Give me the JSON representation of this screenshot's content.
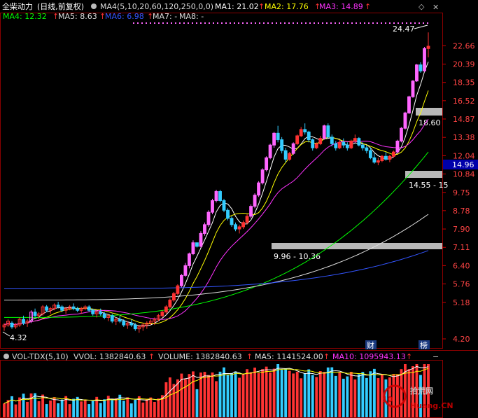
{
  "title": "全柴动力",
  "mode": "(日线,前复权)",
  "indicator_header": {
    "ma_def": "MA4(5,10,20,60,120,250,0,0)",
    "items": [
      {
        "label": "MA1: 21.02",
        "color": "#ffffff"
      },
      {
        "label": "MA2: 17.76",
        "color": "#ffff00"
      },
      {
        "label": "MA3: 14.89",
        "color": "#ff33ff"
      },
      {
        "label": "MA4: 12.32",
        "color": "#00ff00"
      },
      {
        "label": "MA5: 8.63",
        "color": "#dddddd"
      },
      {
        "label": "MA6: 6.98",
        "color": "#3355ff"
      },
      {
        "label": "MA7: -",
        "color": "#dddddd"
      },
      {
        "label": "MA8: -",
        "color": "#dddddd"
      }
    ]
  },
  "price_axis_labels": [
    "22.66",
    "20.39",
    "18.35",
    "16.52",
    "14.87",
    "13.38",
    "12.04",
    "10.84",
    "9.75",
    "8.78",
    "7.90",
    "7.11",
    "6.40",
    "5.76",
    "5.18",
    "4.20"
  ],
  "current_price": "14.96",
  "annotations": {
    "high": "24.47",
    "low": "4.32",
    "level1": "18.60",
    "level2": "14.55 - 15",
    "level3": "9.96 - 10.36"
  },
  "markers": {
    "cai": "财",
    "bang": "榜"
  },
  "volume_header": {
    "name": "VOL-TDX(5,10)",
    "vvol": "VVOL: 1382840.63",
    "volume": "VOLUME: 1382840.63",
    "ma5": "MA5: 1141524.00",
    "ma10": "MA10: 1095943.13"
  },
  "watermark": {
    "number": "10",
    "site": "拾荒网",
    "url": "Huang.CN"
  },
  "colors": {
    "up": "#ff3333",
    "down": "#33ccff",
    "bg": "#000000",
    "grid": "#8b0000",
    "accent": "#ff33ff"
  },
  "chart_data": {
    "type": "candlestick",
    "y_scale": "log",
    "ylim": [
      4.2,
      25.5
    ],
    "candles": [
      [
        4.5,
        4.6,
        4.4,
        4.55
      ],
      [
        4.55,
        4.7,
        4.5,
        4.65
      ],
      [
        4.6,
        4.65,
        4.45,
        4.5
      ],
      [
        4.5,
        4.6,
        4.45,
        4.55
      ],
      [
        4.55,
        4.75,
        4.5,
        4.7
      ],
      [
        4.7,
        4.8,
        4.55,
        4.6
      ],
      [
        4.6,
        4.7,
        4.5,
        4.65
      ],
      [
        4.65,
        4.95,
        4.6,
        4.9
      ],
      [
        4.9,
        5.0,
        4.75,
        4.8
      ],
      [
        4.8,
        4.9,
        4.7,
        4.85
      ],
      [
        4.85,
        5.1,
        4.8,
        5.05
      ],
      [
        5.05,
        5.1,
        4.9,
        4.95
      ],
      [
        4.95,
        5.05,
        4.85,
        5.0
      ],
      [
        5.0,
        5.15,
        4.95,
        5.1
      ],
      [
        5.1,
        5.2,
        5.0,
        5.05
      ],
      [
        5.05,
        5.1,
        4.9,
        4.95
      ],
      [
        4.95,
        5.05,
        4.85,
        5.0
      ],
      [
        5.0,
        5.1,
        4.95,
        5.05
      ],
      [
        5.05,
        5.15,
        4.95,
        5.0
      ],
      [
        5.0,
        5.05,
        4.9,
        4.95
      ],
      [
        4.95,
        5.05,
        4.85,
        5.0
      ],
      [
        5.0,
        5.1,
        4.95,
        5.05
      ],
      [
        5.05,
        5.1,
        4.9,
        4.95
      ],
      [
        4.95,
        5.0,
        4.8,
        4.85
      ],
      [
        4.85,
        4.95,
        4.75,
        4.9
      ],
      [
        4.9,
        5.0,
        4.8,
        4.85
      ],
      [
        4.85,
        4.9,
        4.7,
        4.75
      ],
      [
        4.75,
        4.85,
        4.65,
        4.8
      ],
      [
        4.8,
        4.85,
        4.6,
        4.65
      ],
      [
        4.65,
        4.75,
        4.55,
        4.7
      ],
      [
        4.7,
        4.8,
        4.6,
        4.65
      ],
      [
        4.65,
        4.7,
        4.5,
        4.55
      ],
      [
        4.55,
        4.65,
        4.45,
        4.6
      ],
      [
        4.6,
        4.7,
        4.5,
        4.55
      ],
      [
        4.55,
        4.6,
        4.4,
        4.45
      ],
      [
        4.45,
        4.55,
        4.35,
        4.5
      ],
      [
        4.5,
        4.6,
        4.4,
        4.55
      ],
      [
        4.55,
        4.65,
        4.45,
        4.6
      ],
      [
        4.6,
        4.7,
        4.55,
        4.65
      ],
      [
        4.65,
        4.75,
        4.55,
        4.7
      ],
      [
        4.7,
        4.85,
        4.65,
        4.8
      ],
      [
        4.8,
        4.95,
        4.75,
        4.9
      ],
      [
        4.9,
        5.1,
        4.85,
        5.05
      ],
      [
        5.05,
        5.3,
        5.0,
        5.25
      ],
      [
        5.25,
        5.5,
        5.2,
        5.45
      ],
      [
        5.45,
        5.75,
        5.4,
        5.7
      ],
      [
        5.7,
        6.1,
        5.65,
        6.05
      ],
      [
        6.05,
        6.5,
        6.0,
        6.4
      ],
      [
        6.4,
        6.9,
        6.3,
        6.85
      ],
      [
        6.85,
        7.4,
        6.8,
        7.3
      ],
      [
        7.3,
        7.2,
        7.1,
        7.15
      ],
      [
        7.15,
        7.8,
        7.1,
        7.7
      ],
      [
        7.7,
        8.2,
        7.6,
        8.1
      ],
      [
        8.1,
        8.8,
        8.0,
        8.7
      ],
      [
        8.7,
        9.4,
        8.6,
        9.3
      ],
      [
        9.3,
        9.9,
        9.2,
        9.8
      ],
      [
        9.8,
        9.9,
        9.2,
        9.3
      ],
      [
        9.3,
        9.4,
        8.7,
        8.8
      ],
      [
        8.8,
        8.9,
        8.3,
        8.4
      ],
      [
        8.4,
        8.5,
        8.0,
        8.1
      ],
      [
        8.1,
        8.2,
        7.8,
        7.9
      ],
      [
        7.9,
        8.1,
        7.7,
        8.0
      ],
      [
        8.0,
        8.3,
        7.9,
        8.2
      ],
      [
        8.2,
        8.6,
        8.1,
        8.5
      ],
      [
        8.5,
        9.1,
        8.4,
        9.0
      ],
      [
        9.0,
        9.7,
        8.9,
        9.6
      ],
      [
        9.6,
        10.4,
        9.5,
        10.3
      ],
      [
        10.3,
        11.2,
        10.2,
        11.1
      ],
      [
        11.1,
        12.0,
        11.0,
        11.9
      ],
      [
        11.9,
        12.9,
        11.8,
        12.8
      ],
      [
        12.8,
        13.8,
        12.6,
        13.7
      ],
      [
        13.7,
        14.3,
        13.0,
        13.2
      ],
      [
        13.2,
        13.4,
        12.2,
        12.4
      ],
      [
        12.4,
        12.6,
        11.6,
        11.8
      ],
      [
        11.8,
        12.3,
        11.7,
        12.2
      ],
      [
        12.2,
        13.0,
        12.1,
        12.9
      ],
      [
        12.9,
        13.6,
        12.8,
        13.5
      ],
      [
        13.5,
        14.2,
        13.4,
        14.0
      ],
      [
        14.0,
        14.5,
        13.6,
        13.8
      ],
      [
        13.8,
        13.9,
        13.0,
        13.2
      ],
      [
        13.2,
        13.3,
        12.4,
        12.6
      ],
      [
        12.6,
        13.0,
        12.5,
        12.9
      ],
      [
        12.9,
        13.5,
        12.8,
        13.3
      ],
      [
        13.3,
        14.4,
        13.2,
        14.3
      ],
      [
        14.3,
        14.5,
        13.3,
        13.4
      ],
      [
        13.4,
        13.6,
        12.7,
        12.9
      ],
      [
        12.9,
        13.1,
        12.4,
        12.6
      ],
      [
        12.6,
        13.2,
        12.5,
        13.0
      ],
      [
        13.0,
        13.3,
        12.6,
        12.8
      ],
      [
        12.8,
        13.0,
        12.4,
        12.6
      ],
      [
        12.6,
        13.2,
        12.5,
        13.1
      ],
      [
        13.1,
        13.6,
        13.0,
        13.3
      ],
      [
        13.3,
        13.4,
        12.7,
        12.8
      ],
      [
        12.8,
        13.0,
        12.4,
        12.6
      ],
      [
        12.6,
        12.8,
        12.2,
        12.4
      ],
      [
        12.4,
        12.6,
        11.8,
        11.9
      ],
      [
        11.9,
        12.2,
        11.5,
        11.6
      ],
      [
        11.6,
        11.9,
        11.4,
        11.7
      ],
      [
        11.7,
        12.1,
        11.6,
        12.0
      ],
      [
        12.0,
        12.3,
        11.7,
        11.8
      ],
      [
        11.8,
        12.1,
        11.6,
        12.0
      ],
      [
        12.0,
        12.4,
        11.9,
        12.3
      ],
      [
        12.3,
        13.2,
        12.2,
        13.1
      ],
      [
        13.1,
        14.2,
        13.0,
        14.1
      ],
      [
        14.1,
        15.5,
        14.0,
        15.4
      ],
      [
        15.4,
        17.0,
        15.3,
        16.9
      ],
      [
        16.9,
        18.6,
        16.8,
        18.5
      ],
      [
        18.5,
        20.4,
        18.4,
        20.3
      ],
      [
        20.3,
        20.6,
        19.4,
        19.6
      ],
      [
        19.6,
        22.5,
        19.5,
        22.3
      ],
      [
        22.3,
        24.47,
        21.2,
        22.6
      ]
    ],
    "volume_max": 1900000
  }
}
